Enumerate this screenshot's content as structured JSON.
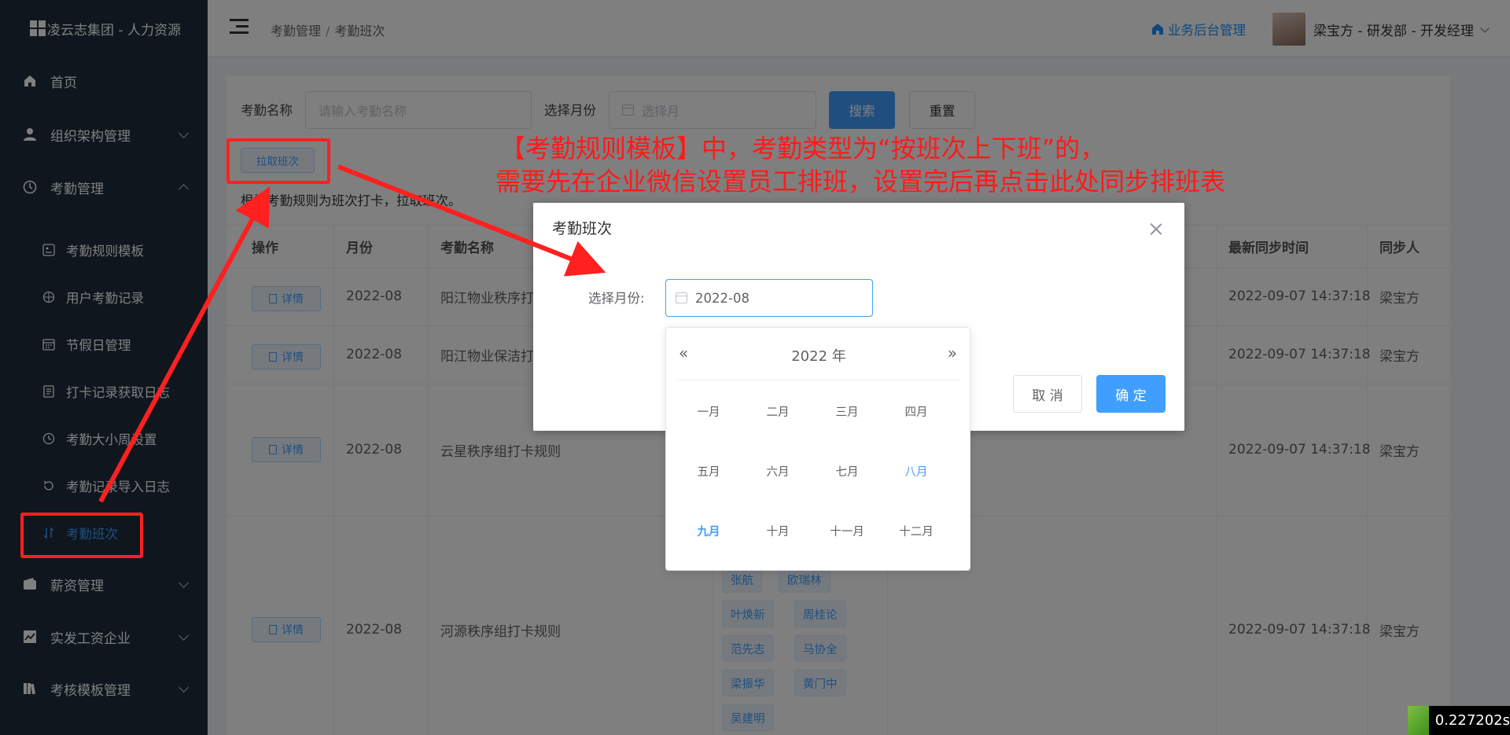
{
  "brand": {
    "title": "凌云志集团 - 人力资源"
  },
  "sidebar": {
    "items": [
      {
        "label": "首页",
        "icon": "home-icon"
      },
      {
        "label": "组织架构管理",
        "icon": "user-icon"
      },
      {
        "label": "考勤管理",
        "icon": "clock-icon"
      }
    ],
    "sub_items": [
      {
        "label": "考勤规则模板",
        "icon": "template-icon"
      },
      {
        "label": "用户考勤记录",
        "icon": "target-icon"
      },
      {
        "label": "节假日管理",
        "icon": "calendar-icon"
      },
      {
        "label": "打卡记录获取日志",
        "icon": "document-icon"
      },
      {
        "label": "考勤大小周设置",
        "icon": "clock-icon"
      },
      {
        "label": "考勤记录导入日志",
        "icon": "refresh-icon"
      },
      {
        "label": "考勤班次",
        "icon": "sort-icon"
      }
    ],
    "bottom_items": [
      {
        "label": "薪资管理",
        "icon": "wallet-icon"
      },
      {
        "label": "实发工资企业",
        "icon": "chart-icon"
      },
      {
        "label": "考核模板管理",
        "icon": "book-icon"
      }
    ]
  },
  "header": {
    "breadcrumb": [
      "考勤管理",
      "考勤班次"
    ],
    "biz_link": "业务后台管理",
    "user": "梁宝方 - 研发部 - 开发经理"
  },
  "filter": {
    "name_label": "考勤名称",
    "name_placeholder": "请输入考勤名称",
    "month_label": "选择月份",
    "month_placeholder": "选择月",
    "search": "搜索",
    "reset": "重置",
    "pull": "拉取班次",
    "hint": "根据考勤规则为班次打卡，拉取班次。"
  },
  "table": {
    "headers": [
      "操作",
      "月份",
      "考勤名称",
      "最新同步时间",
      "同步人"
    ],
    "detail_label": "详情",
    "rows": [
      {
        "month": "2022-08",
        "name": "阳江物业秩序打",
        "sync_time": "2022-09-07 14:37:18",
        "user": "梁宝方"
      },
      {
        "month": "2022-08",
        "name": "阳江物业保洁打",
        "sync_time": "2022-09-07 14:37:18",
        "user": "梁宝方"
      },
      {
        "month": "2022-08",
        "name": "云星秩序组打卡规则",
        "sync_time": "2022-09-07 14:37:18",
        "user": "梁宝方"
      },
      {
        "month": "2022-08",
        "name": "河源秩序组打卡规则",
        "sync_time": "2022-09-07 14:37:18",
        "user": "梁宝方"
      }
    ],
    "tags": [
      "张航",
      "欧瑞林",
      "叶焕新",
      "周桂论",
      "范先志",
      "马协全",
      "梁振华",
      "黄门中",
      "吴建明"
    ]
  },
  "dialog": {
    "title": "考勤班次",
    "label": "选择月份:",
    "value": "2022-08",
    "cancel": "取 消",
    "confirm": "确 定"
  },
  "picker": {
    "year": "2022 年",
    "prev": "«",
    "next": "»",
    "months": [
      "一月",
      "二月",
      "三月",
      "四月",
      "五月",
      "六月",
      "七月",
      "八月",
      "九月",
      "十月",
      "十一月",
      "十二月"
    ],
    "selected_month_index": 7,
    "today_month_index": 8
  },
  "annotation": {
    "line1": "【考勤规则模板】中，考勤类型为“按班次上下班”的，",
    "line2": "需要先在企业微信设置员工排班，设置完后再点击此处同步排班表",
    "color": "#ff1a1a"
  },
  "timer": "0.227202s"
}
